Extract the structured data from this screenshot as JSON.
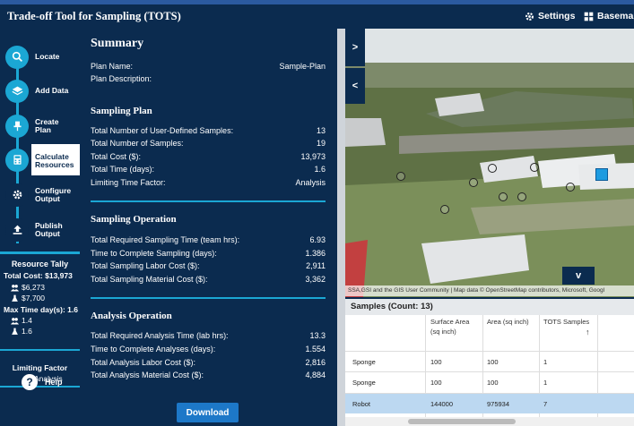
{
  "header": {
    "title": "Trade-off Tool for Sampling (TOTS)",
    "settings_label": "Settings",
    "basemap_label": "Basemap"
  },
  "sidebar": {
    "steps": [
      {
        "label": "Locate",
        "icon": "search-icon"
      },
      {
        "label": "Add Data",
        "icon": "layers-icon"
      },
      {
        "label": "Create\nPlan",
        "icon": "pin-icon"
      },
      {
        "label": "Calculate\nResources",
        "icon": "calculator-icon"
      },
      {
        "label": "Configure\nOutput",
        "icon": "gear-icon"
      },
      {
        "label": "Publish\nOutput",
        "icon": "upload-icon"
      }
    ],
    "tally": {
      "title": "Resource Tally",
      "total_cost": "Total Cost: $13,973",
      "labor_cost": "$6,273",
      "material_cost": "$7,700",
      "max_time": "Max Time day(s): 1.6",
      "sampling_time": "1.4",
      "analysis_time": "1.6"
    },
    "limiting": {
      "title": "Limiting Factor",
      "value": "Analysis"
    },
    "help_label": "Help"
  },
  "summary": {
    "title": "Summary",
    "plan": [
      {
        "label": "Plan Name:",
        "value": "Sample-Plan"
      },
      {
        "label": "Plan Description:",
        "value": ""
      }
    ],
    "sampling_plan": {
      "title": "Sampling Plan",
      "rows": [
        {
          "label": "Total Number of User-Defined Samples:",
          "value": "13"
        },
        {
          "label": "Total Number of Samples:",
          "value": "19"
        },
        {
          "label": "Total Cost ($):",
          "value": "13,973"
        },
        {
          "label": "Total Time (days):",
          "value": "1.6"
        },
        {
          "label": "Limiting Time Factor:",
          "value": "Analysis"
        }
      ]
    },
    "sampling_operation": {
      "title": "Sampling Operation",
      "rows": [
        {
          "label": "Total Required Sampling Time (team hrs):",
          "value": "6.93"
        },
        {
          "label": "Time to Complete Sampling (days):",
          "value": "1.386"
        },
        {
          "label": "Total Sampling Labor Cost ($):",
          "value": "2,911"
        },
        {
          "label": "Total Sampling Material Cost ($):",
          "value": "3,362"
        }
      ]
    },
    "analysis_operation": {
      "title": "Analysis Operation",
      "rows": [
        {
          "label": "Total Required Analysis Time (lab hrs):",
          "value": "13.3"
        },
        {
          "label": "Time to Complete Analyses (days):",
          "value": "1.554"
        },
        {
          "label": "Total Analysis Labor Cost ($):",
          "value": "2,816"
        },
        {
          "label": "Total Analysis Material Cost ($):",
          "value": "4,884"
        }
      ]
    },
    "download_label": "Download"
  },
  "map": {
    "expand_label": ">",
    "collapse_label": "<",
    "down_label": "v",
    "attribution": "SSA,GSI and the GIS User Community | Map data © OpenStreetMap contributors, Microsoft, Googl"
  },
  "samples": {
    "title": "Samples (Count: 13)",
    "columns": [
      "Surface Area\n(sq inch)",
      "Area (sq inch)",
      "TOTS Samples"
    ],
    "sort_icon": "sort-up-icon",
    "rows": [
      {
        "type": "Sponge",
        "surface_area": "100",
        "area": "100",
        "tots": "1"
      },
      {
        "type": "Sponge",
        "surface_area": "100",
        "area": "100",
        "tots": "1"
      },
      {
        "type": "Robot",
        "surface_area": "144000",
        "area": "975934",
        "tots": "7"
      }
    ]
  }
}
